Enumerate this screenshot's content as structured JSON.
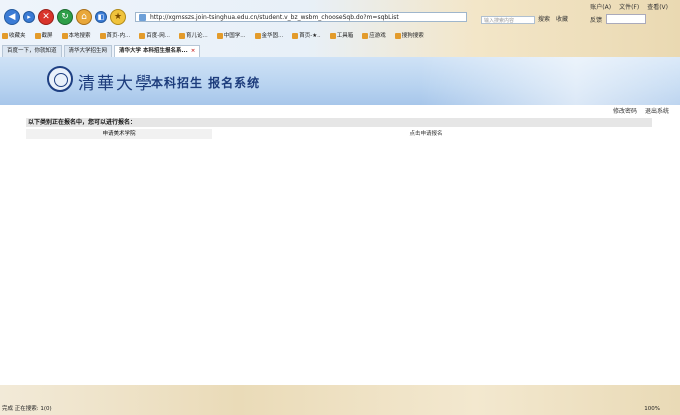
{
  "browser": {
    "menu": [
      "账户(A)",
      "文件(F)",
      "查看(V)"
    ],
    "address": "http://xgmsszs.join-tsinghua.edu.cn/student.v_bz_wsbm_chooseSqb.do?m=sqbList",
    "search_placeholder": "输入搜索内容",
    "tools": [
      "搜索",
      "收藏"
    ],
    "tools2": [
      "反馈"
    ],
    "favorites": [
      "收藏夹",
      "截屏",
      "本地搜索",
      "首页-内...",
      "百度-网...",
      "育儿论...",
      "中国学...",
      "金华固...",
      "首页-★..",
      "工具箱",
      "应游戏",
      "搜狗搜索"
    ],
    "tabs": [
      {
        "label": "百度一下，你就知道"
      },
      {
        "label": "清华大学招生网"
      },
      {
        "label": "清华大学 本科招生报名系..."
      }
    ]
  },
  "page": {
    "school_name": "清華大學",
    "system_title": "本科招生  报名系统",
    "links": {
      "change_password": "修改密码",
      "logout": "退出系统"
    },
    "notice": "以下类别正在报名中，您可以进行报名：",
    "category": "申请美术学院",
    "action": "点击申请报名"
  },
  "statusbar": {
    "left": "完成  正在搜索: 1(0)",
    "right": "100%"
  }
}
